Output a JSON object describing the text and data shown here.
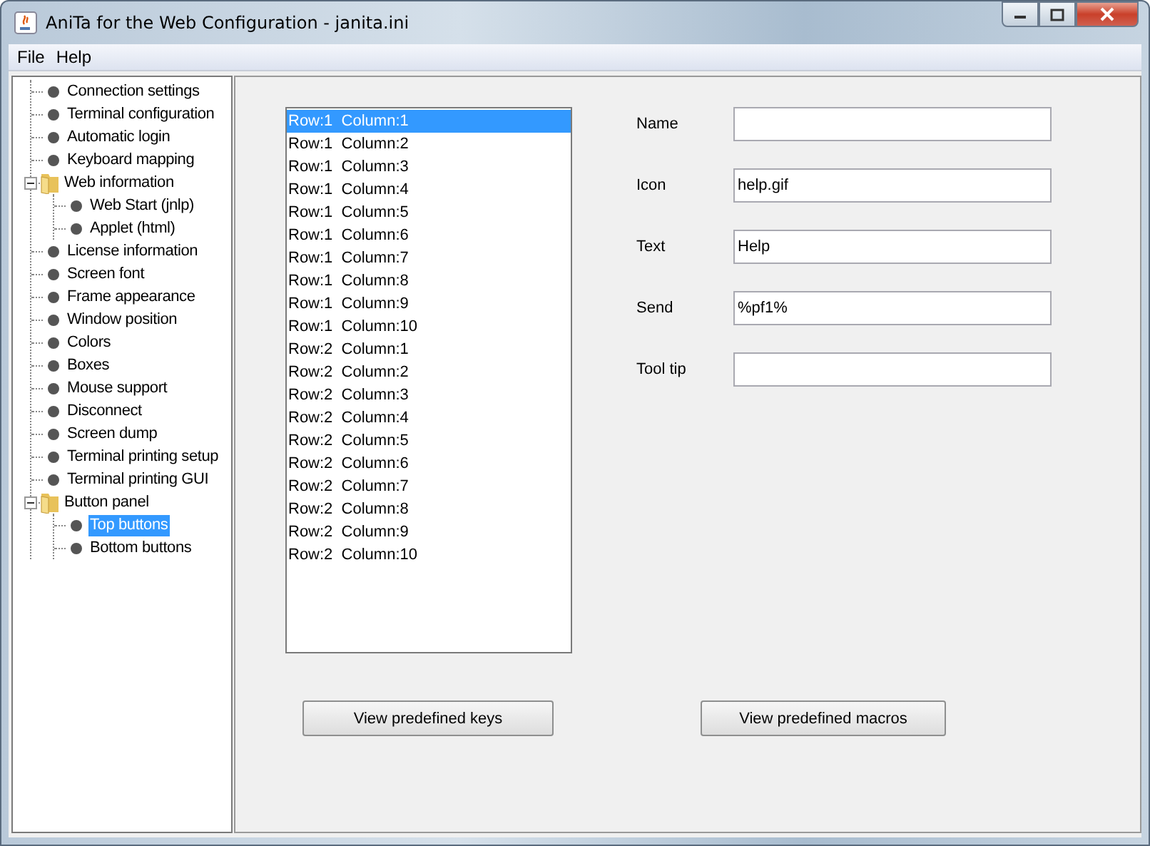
{
  "window": {
    "title": "AniTa for the Web Configuration - janita.ini"
  },
  "menu": [
    "File",
    "Help"
  ],
  "tree": [
    {
      "kind": "leaf",
      "label": "Connection settings",
      "selected": false
    },
    {
      "kind": "leaf",
      "label": "Terminal configuration",
      "selected": false
    },
    {
      "kind": "leaf",
      "label": "Automatic login",
      "selected": false
    },
    {
      "kind": "leaf",
      "label": "Keyboard mapping",
      "selected": false
    },
    {
      "kind": "folder",
      "label": "Web information",
      "selected": false,
      "expanded": true,
      "children": [
        {
          "kind": "leaf",
          "label": "Web Start (jnlp)",
          "selected": false
        },
        {
          "kind": "leaf",
          "label": "Applet (html)",
          "selected": false
        }
      ]
    },
    {
      "kind": "leaf",
      "label": "License information",
      "selected": false
    },
    {
      "kind": "leaf",
      "label": "Screen font",
      "selected": false
    },
    {
      "kind": "leaf",
      "label": "Frame appearance",
      "selected": false
    },
    {
      "kind": "leaf",
      "label": "Window position",
      "selected": false
    },
    {
      "kind": "leaf",
      "label": "Colors",
      "selected": false
    },
    {
      "kind": "leaf",
      "label": "Boxes",
      "selected": false
    },
    {
      "kind": "leaf",
      "label": "Mouse support",
      "selected": false
    },
    {
      "kind": "leaf",
      "label": "Disconnect",
      "selected": false
    },
    {
      "kind": "leaf",
      "label": "Screen dump",
      "selected": false
    },
    {
      "kind": "leaf",
      "label": "Terminal printing setup",
      "selected": false
    },
    {
      "kind": "leaf",
      "label": "Terminal printing GUI",
      "selected": false
    },
    {
      "kind": "folder",
      "label": "Button panel",
      "selected": false,
      "expanded": true,
      "children": [
        {
          "kind": "leaf",
          "label": "Top buttons",
          "selected": true
        },
        {
          "kind": "leaf",
          "label": "Bottom buttons",
          "selected": false
        }
      ]
    }
  ],
  "button_list": [
    {
      "label": "Row:1  Column:1",
      "selected": true
    },
    {
      "label": "Row:1  Column:2",
      "selected": false
    },
    {
      "label": "Row:1  Column:3",
      "selected": false
    },
    {
      "label": "Row:1  Column:4",
      "selected": false
    },
    {
      "label": "Row:1  Column:5",
      "selected": false
    },
    {
      "label": "Row:1  Column:6",
      "selected": false
    },
    {
      "label": "Row:1  Column:7",
      "selected": false
    },
    {
      "label": "Row:1  Column:8",
      "selected": false
    },
    {
      "label": "Row:1  Column:9",
      "selected": false
    },
    {
      "label": "Row:1  Column:10",
      "selected": false
    },
    {
      "label": "Row:2  Column:1",
      "selected": false
    },
    {
      "label": "Row:2  Column:2",
      "selected": false
    },
    {
      "label": "Row:2  Column:3",
      "selected": false
    },
    {
      "label": "Row:2  Column:4",
      "selected": false
    },
    {
      "label": "Row:2  Column:5",
      "selected": false
    },
    {
      "label": "Row:2  Column:6",
      "selected": false
    },
    {
      "label": "Row:2  Column:7",
      "selected": false
    },
    {
      "label": "Row:2  Column:8",
      "selected": false
    },
    {
      "label": "Row:2  Column:9",
      "selected": false
    },
    {
      "label": "Row:2  Column:10",
      "selected": false
    }
  ],
  "fields": [
    {
      "label": "Name"
    },
    {
      "label": "Icon",
      "value": "help.gif"
    },
    {
      "label": "Text",
      "value": "Help"
    },
    {
      "label": "Send",
      "value": "%pf1%"
    },
    {
      "label": "Tool tip"
    }
  ],
  "buttons": [
    "View predefined keys",
    "View predefined macros"
  ]
}
